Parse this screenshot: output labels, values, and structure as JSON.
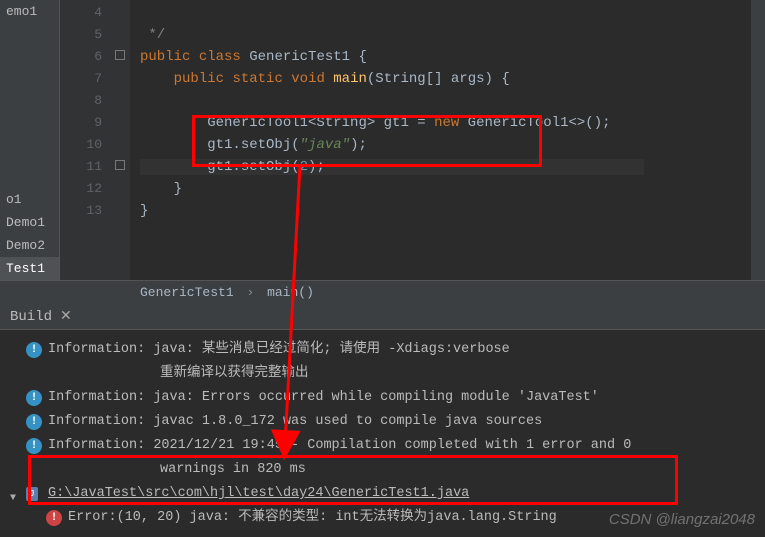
{
  "sidebar": {
    "items": [
      "emo1",
      "o1",
      "Demo1",
      "Demo2",
      "Test1"
    ]
  },
  "gutter": {
    "lines": [
      "4",
      "5",
      "6",
      "7",
      "8",
      "9",
      "10",
      "11",
      "12",
      "13"
    ]
  },
  "code": {
    "l4": "*/",
    "l5_kw1": "public",
    "l5_kw2": "class",
    "l5_cls": "GenericTest1",
    "l5_brace": "{",
    "l6_kw1": "public",
    "l6_kw2": "static",
    "l6_kw3": "void",
    "l6_m": "main",
    "l6_p": "(String[] args)",
    "l6_brace": "{",
    "l8_a": "GenericTool1<String> gt1 = ",
    "l8_new": "new",
    "l8_b": " GenericTool1<>();",
    "l9_a": "gt1.setObj(",
    "l9_s": "\"java\"",
    "l9_b": ");",
    "l10_a": "gt1.setObj(",
    "l10_n": "2",
    "l10_b": ");",
    "l11": "}",
    "l12": "}"
  },
  "breadcrumb": {
    "item1": "GenericTest1",
    "item2": "main()"
  },
  "build": {
    "title": "Build",
    "msg1": "Information: java: 某些消息已经过简化; 请使用 -Xdiags:verbose",
    "msg1b": "重新编译以获得完整输出",
    "msg2": "Information: java: Errors occurred while compiling module 'JavaTest'",
    "msg3": "Information: javac 1.8.0_172 was used to compile java sources",
    "msg4": "Information: 2021/12/21 19:45 - Compilation completed with 1 error and 0",
    "msg4b": "warnings in 820 ms",
    "file": "G:\\JavaTest\\src\\com\\hjl\\test\\day24\\GenericTest1.java",
    "err": "Error:(10, 20)  java: 不兼容的类型: int无法转换为java.lang.String"
  },
  "watermark": "CSDN @liangzai2048"
}
